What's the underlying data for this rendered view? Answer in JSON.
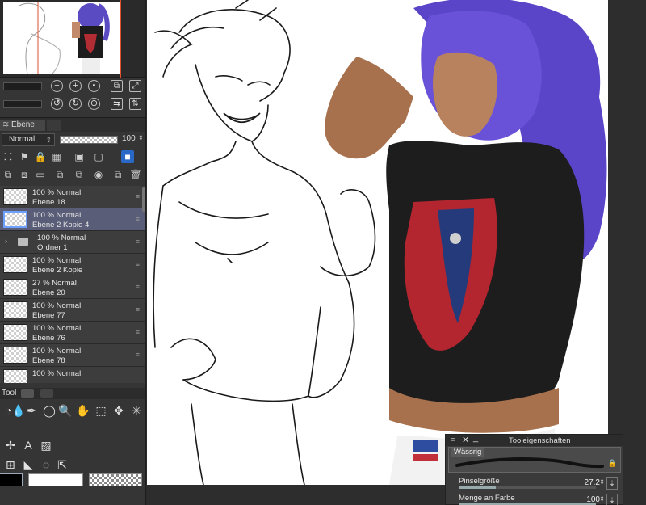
{
  "layer_panel": {
    "tab_label": "Ebene",
    "blend_mode": "Normal",
    "opacity": "100",
    "layers": [
      {
        "opacity_mode": "100 % Normal",
        "name": "Ebene 18",
        "selected": false,
        "folder": false
      },
      {
        "opacity_mode": "100 % Normal",
        "name": "Ebene 2 Kopie 4",
        "selected": true,
        "folder": false
      },
      {
        "opacity_mode": "100 % Normal",
        "name": "Ordner 1",
        "selected": false,
        "folder": true
      },
      {
        "opacity_mode": "100 % Normal",
        "name": "Ebene 2 Kopie",
        "selected": false,
        "folder": false
      },
      {
        "opacity_mode": "27 % Normal",
        "name": "Ebene 20",
        "selected": false,
        "folder": false
      },
      {
        "opacity_mode": "100 % Normal",
        "name": "Ebene 77",
        "selected": false,
        "folder": false
      },
      {
        "opacity_mode": "100 % Normal",
        "name": "Ebene 76",
        "selected": false,
        "folder": false
      },
      {
        "opacity_mode": "100 % Normal",
        "name": "Ebene 78",
        "selected": false,
        "folder": false
      },
      {
        "opacity_mode": "100 % Normal",
        "name": "",
        "selected": false,
        "folder": false
      }
    ]
  },
  "tool_panel": {
    "label": "Tool"
  },
  "colors": {
    "main": "#000000",
    "sub": "#ffffff",
    "accent_selected": "#5a5d78",
    "navigator_marker": "#e0502c"
  },
  "tool_properties": {
    "title": "Tooleigenschaften",
    "brush_name": "Wässrig",
    "brush_size_label": "Pinselgröße",
    "brush_size_value": "27.2",
    "brush_size_fraction": 0.27,
    "paint_amount_label": "Menge an Farbe",
    "paint_amount_value": "100",
    "paint_amount_fraction": 1.0
  }
}
